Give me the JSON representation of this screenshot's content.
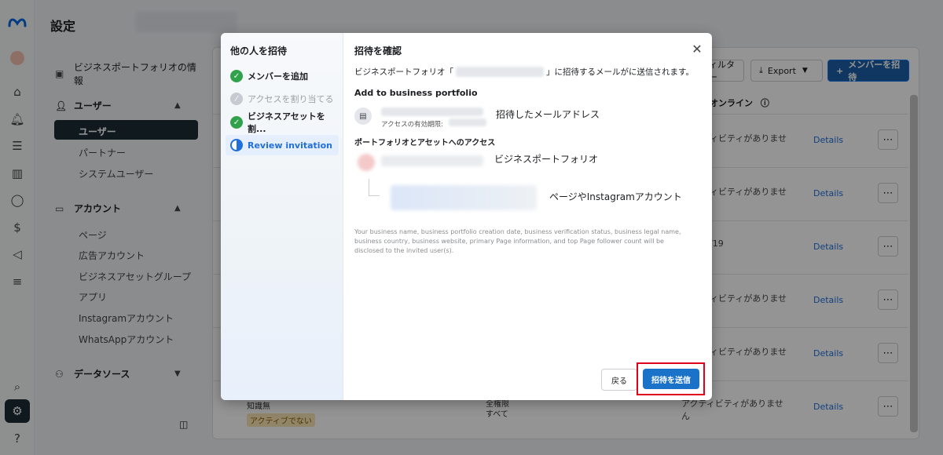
{
  "header": {
    "title": "設定"
  },
  "sidebar": {
    "business_info": "ビジネスポートフォリオの情報",
    "users_section": "ユーザー",
    "users_items": [
      "ユーザー",
      "パートナー",
      "システムユーザー"
    ],
    "accounts_section": "アカウント",
    "accounts_items": [
      "ページ",
      "広告アカウント",
      "ビジネスアセットグループ",
      "アプリ",
      "Instagramアカウント",
      "WhatsAppアカウント"
    ],
    "datasource_section": "データソース"
  },
  "content": {
    "filter_label": "ィルター",
    "export_label": "Export",
    "invite_label": "メンバーを招待",
    "column_header": "オンライン",
    "rows": [
      {
        "status": "ィビティがありませ",
        "details": "Details"
      },
      {
        "status": "ィビティがありませ",
        "details": "Details"
      },
      {
        "status": "/19",
        "details": "Details"
      },
      {
        "status": "ィビティがありませ",
        "details": "Details"
      },
      {
        "status": "ィビティがありませ",
        "details": "Details"
      },
      {
        "status": "アクティビティがありませ",
        "details": "Details"
      }
    ],
    "bottom_name": "知識無",
    "bottom_badge": "アクティブでない",
    "bottom_access": "全権限",
    "bottom_access2": "すべて",
    "bottom_tail": "ん"
  },
  "modal": {
    "steps_title": "他の人を招待",
    "steps": [
      {
        "label": "メンバーを追加",
        "state": "done"
      },
      {
        "label": "アクセスを割り当てる",
        "state": "skip"
      },
      {
        "label": "ビジネスアセットを割...",
        "state": "done"
      },
      {
        "label": "Review invitation",
        "state": "current"
      }
    ],
    "pane_title": "招待を確認",
    "desc_prefix": "ビジネスポートフォリオ「",
    "desc_suffix": "」に招待するメールがに送信されます。",
    "add_heading": "Add to business portfolio",
    "expiry_label": "アクセスの有効期限:",
    "email_annotation": "招待したメールアドレス",
    "access_heading": "ポートフォリオとアセットへのアクセス",
    "biz_annotation": "ビジネスポートフォリオ",
    "page_annotation": "ページやInstagramアカウント",
    "disclaimer": "Your business name, business portfolio creation date, business verification status, business legal name, business country, business website, primary Page information, and top Page follower count will be disclosed to the invited user(s).",
    "back_label": "戻る",
    "send_label": "招待を送信"
  },
  "colors": {
    "accent": "#1a73c8",
    "highlight": "#e0001b",
    "done": "#31a24c"
  }
}
